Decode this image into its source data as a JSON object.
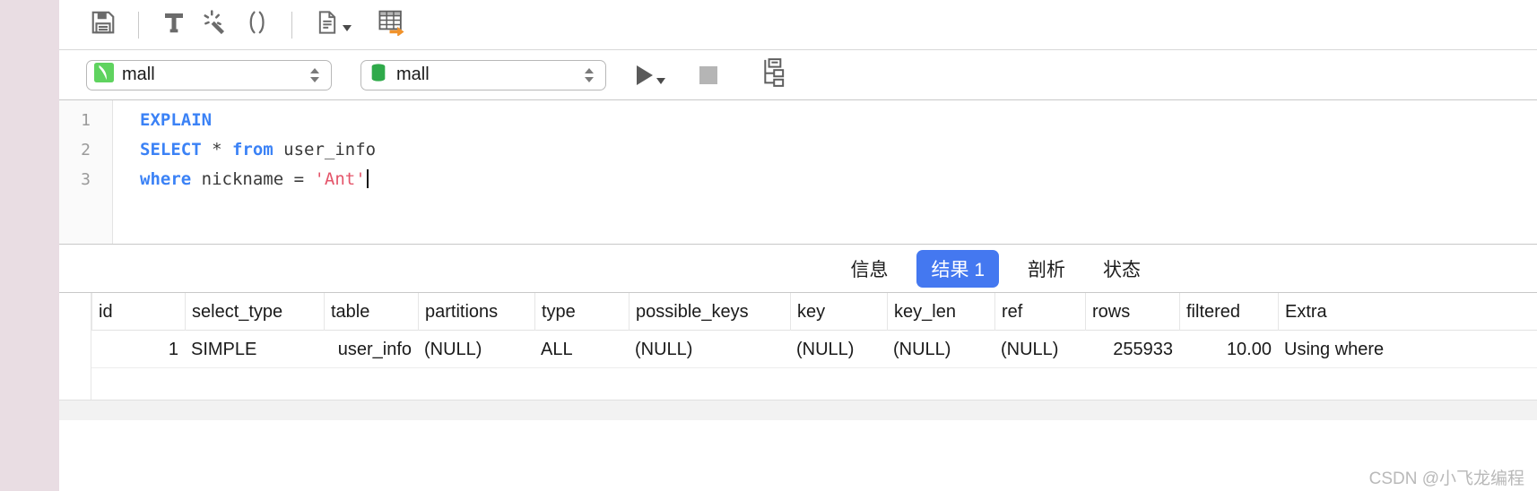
{
  "toolbar": {
    "items": [
      {
        "name": "save-icon",
        "title": "保存"
      },
      {
        "name": "separator",
        "title": ""
      },
      {
        "name": "beautify-sql-icon",
        "title": "格式化"
      },
      {
        "name": "magic-wand-icon",
        "title": "美化"
      },
      {
        "name": "parentheses-icon",
        "title": "()"
      },
      {
        "name": "separator",
        "title": ""
      },
      {
        "name": "explain-document-icon",
        "title": "解释"
      },
      {
        "name": "export-table-icon",
        "title": "导出结果"
      }
    ]
  },
  "connection_bar": {
    "connection": {
      "icon": "mysql-dolphin-icon",
      "value": "mall"
    },
    "database": {
      "icon": "database-cylinder-icon",
      "value": "mall"
    },
    "run_button": "run-icon",
    "stop_button": "stop-icon",
    "explain_plan_button": "query-plan-tree-icon"
  },
  "editor": {
    "line_numbers": [
      "1",
      "2",
      "3"
    ],
    "lines": [
      [
        {
          "t": "EXPLAIN",
          "c": "kw"
        }
      ],
      [
        {
          "t": "SELECT",
          "c": "kw"
        },
        {
          "t": " * ",
          "c": "op"
        },
        {
          "t": "from",
          "c": "kw"
        },
        {
          "t": " user_info",
          "c": "op"
        }
      ],
      [
        {
          "t": "where",
          "c": "kw"
        },
        {
          "t": " nickname = ",
          "c": "op"
        },
        {
          "t": "'Ant'",
          "c": "str"
        }
      ]
    ]
  },
  "result_tabs": {
    "tabs": [
      {
        "label": "信息",
        "active": false
      },
      {
        "label": "结果 1",
        "active": true
      },
      {
        "label": "剖析",
        "active": false
      },
      {
        "label": "状态",
        "active": false
      }
    ],
    "active_color": "#4478f0"
  },
  "result_grid": {
    "columns": [
      "id",
      "select_type",
      "table",
      "partitions",
      "type",
      "possible_keys",
      "key",
      "key_len",
      "ref",
      "rows",
      "filtered",
      "Extra"
    ],
    "rows": [
      {
        "id": "1",
        "select_type": "SIMPLE",
        "table": "user_info",
        "partitions": "(NULL)",
        "type": "ALL",
        "possible_keys": "(NULL)",
        "key": "(NULL)",
        "key_len": "(NULL)",
        "ref": "(NULL)",
        "rows": "255933",
        "filtered": "10.00",
        "Extra": "Using where"
      }
    ],
    "null_text": "(NULL)"
  },
  "watermark": {
    "text": "CSDN @小飞龙编程"
  }
}
